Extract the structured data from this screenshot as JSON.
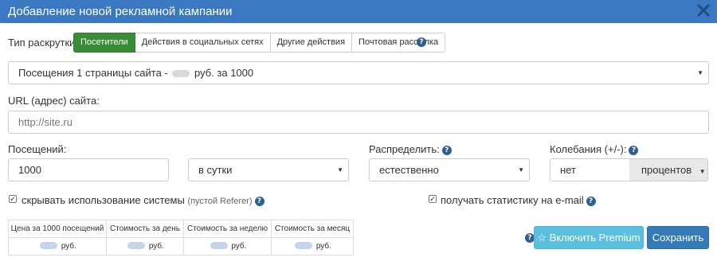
{
  "dialog": {
    "title": "Добавление новой рекламной кампании"
  },
  "promotion_type": {
    "label": "Тип раскрутки:",
    "options": [
      {
        "label": "Посетители",
        "active": true
      },
      {
        "label": "Действия в социальных сетях",
        "active": false
      },
      {
        "label": "Другие действия",
        "active": false
      },
      {
        "label": "Почтовая рассылка",
        "active": false
      }
    ]
  },
  "tariff": {
    "prefix": "Посещения 1 страницы сайта -",
    "suffix": "руб. за 1000"
  },
  "url": {
    "label": "URL (адрес) сайта:",
    "placeholder": "http://site.ru"
  },
  "visits": {
    "label": "Посещений:",
    "value": "1000",
    "period": "в сутки"
  },
  "distribute": {
    "label": "Распределить:",
    "value": "естественно"
  },
  "fluctuation": {
    "label": "Колебания (+/-):",
    "value": "нет",
    "unit": "процентов"
  },
  "options": {
    "hide_label": "скрывать использование системы",
    "hide_note": "(пустой Referer)",
    "hide_checked": true,
    "email_label": "получать статистику на e-mail",
    "email_checked": true
  },
  "prices": {
    "headers": [
      "Цена за 1000 посещений",
      "Стоимость за день",
      "Стоимость за неделю",
      "Стоимость за месяц"
    ],
    "unit": "руб."
  },
  "actions": {
    "premium_label": "Включить Premium",
    "save_label": "Сохранить"
  },
  "icons": {
    "close": "close-icon",
    "help": "question-circle-icon",
    "premium": "star-outline-icon",
    "check": "checkmark-icon"
  },
  "colors": {
    "header": "#3a78c2",
    "active_segment": "#3a8d37",
    "premium": "#5bc0de",
    "save": "#337ab7",
    "help": "#2f5f93"
  }
}
